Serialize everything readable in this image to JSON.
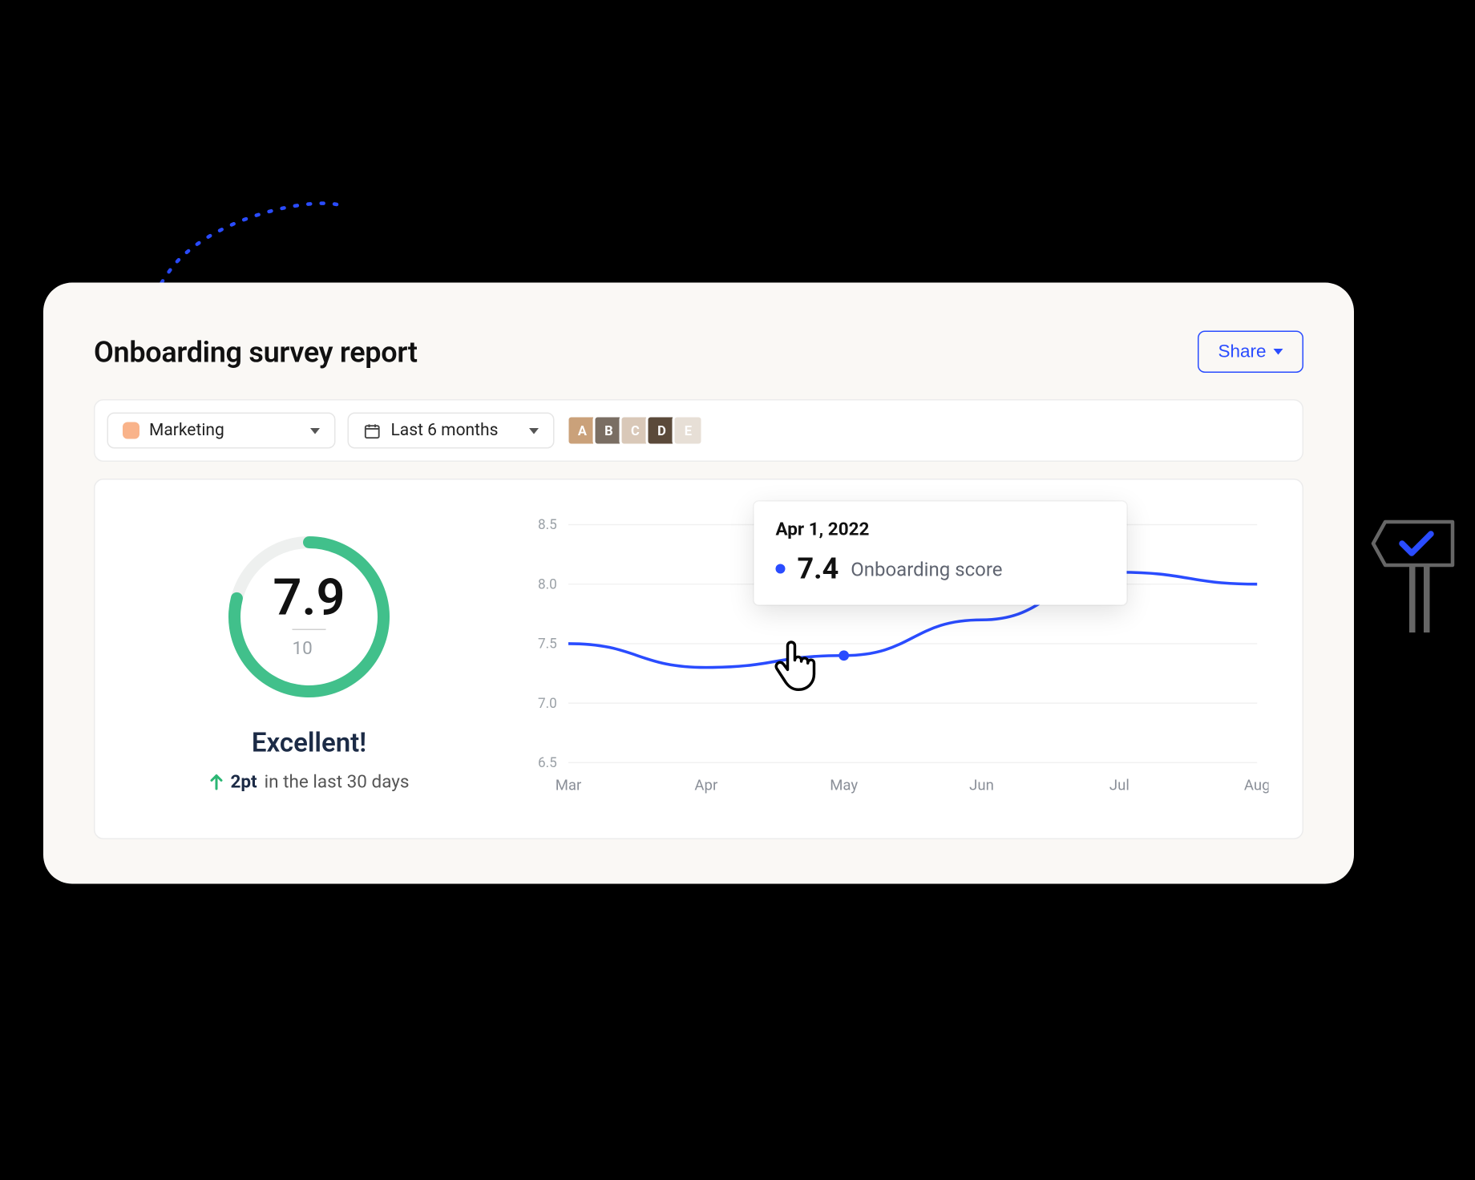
{
  "header": {
    "title": "Onboarding survey report",
    "share_label": "Share"
  },
  "filters": {
    "segment": {
      "label": "Marketing",
      "swatch_color": "#f9b38a"
    },
    "period": {
      "label": "Last 6 months"
    },
    "avatars": [
      {
        "initial": "A",
        "bg": "#caa17a"
      },
      {
        "initial": "B",
        "bg": "#7a6e63"
      },
      {
        "initial": "C",
        "bg": "#d9c8b8"
      },
      {
        "initial": "D",
        "bg": "#5b4a3a"
      },
      {
        "initial": "E",
        "bg": "#e7dfd6"
      }
    ]
  },
  "gauge": {
    "score": "7.9",
    "max_label": "10",
    "max": 10,
    "rating": "Excellent!",
    "delta_value": "2pt",
    "delta_caption": "in the last 30 days",
    "ring_color": "#41c08b"
  },
  "tooltip": {
    "date": "Apr 1, 2022",
    "value": "7.4",
    "label": "Onboarding score"
  },
  "colors": {
    "accent": "#2a4cff"
  },
  "chart_data": {
    "type": "line",
    "title": "",
    "xlabel": "",
    "ylabel": "",
    "ylim": [
      6.5,
      8.5
    ],
    "y_ticks": [
      6.5,
      7.0,
      7.5,
      8.0,
      8.5
    ],
    "categories": [
      "Mar",
      "Apr",
      "May",
      "Jun",
      "Jul",
      "Aug"
    ],
    "series": [
      {
        "name": "Onboarding score",
        "color": "#2a4cff",
        "values": [
          7.5,
          7.3,
          7.4,
          7.7,
          8.1,
          8.0
        ]
      }
    ],
    "highlight": {
      "index": 2,
      "date": "Apr 1, 2022",
      "value": 7.4
    }
  }
}
